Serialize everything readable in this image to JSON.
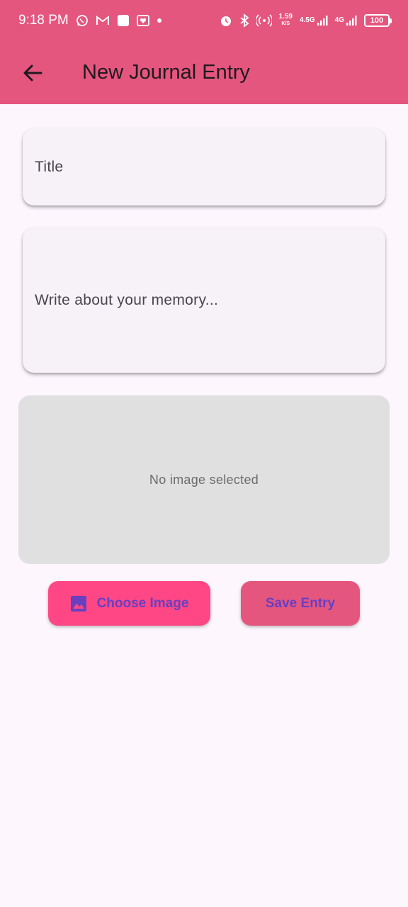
{
  "status_bar": {
    "time": "9:18 PM",
    "net_speed_value": "1.59",
    "net_speed_unit": "K/S",
    "net_type_1": "4.5G",
    "net_type_2": "4G",
    "battery": "100"
  },
  "app_bar": {
    "title": "New Journal Entry"
  },
  "form": {
    "title_placeholder": "Title",
    "title_value": "",
    "memory_placeholder": "Write about your memory...",
    "memory_value": ""
  },
  "image_preview": {
    "empty_text": "No image selected"
  },
  "actions": {
    "choose_image_label": "Choose Image",
    "save_entry_label": "Save Entry"
  },
  "colors": {
    "app_bar": "#e5567f",
    "background": "#fdf6fd",
    "choose_button": "#ff4785",
    "save_button": "#e5567f",
    "button_text": "#6a3fc0"
  }
}
